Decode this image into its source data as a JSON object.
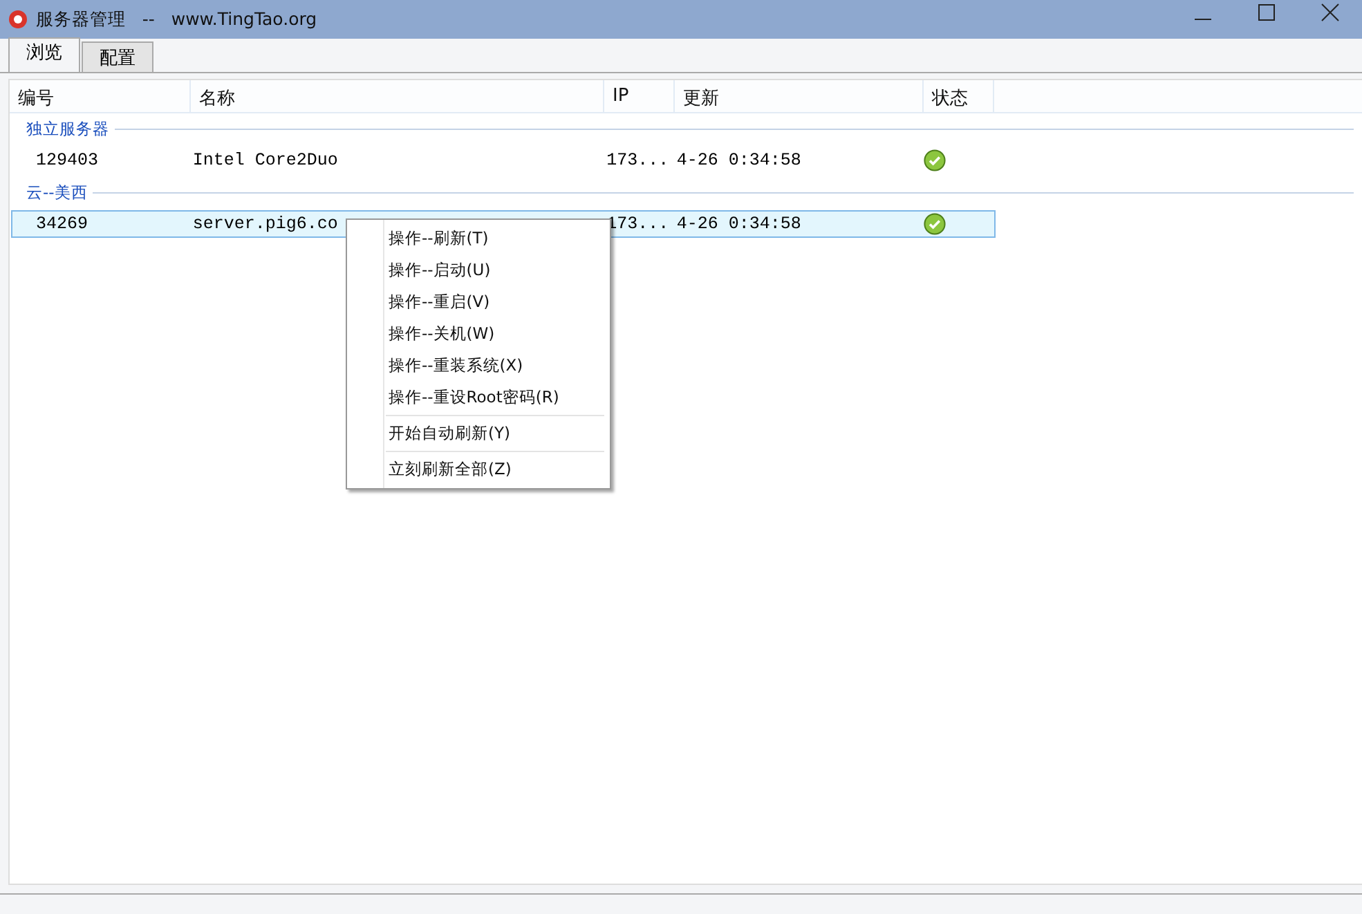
{
  "window": {
    "title": "服务器管理   --   www.TingTao.org"
  },
  "tabs": [
    {
      "label": "浏览",
      "selected": true
    },
    {
      "label": "配置",
      "selected": false
    }
  ],
  "table": {
    "columns": [
      "编号",
      "名称",
      "IP",
      "更新",
      "状态"
    ],
    "groups": [
      {
        "label": "独立服务器",
        "rows": [
          {
            "id": "129403",
            "name": "Intel Core2Duo",
            "ip": "173...",
            "updated": "4-26 0:34:58",
            "healthy": true,
            "selected": false
          }
        ]
      },
      {
        "label": "云--美西",
        "rows": [
          {
            "id": "34269",
            "name": "server.pig6.co",
            "ip": "173...",
            "updated": "4-26 0:34:58",
            "healthy": true,
            "selected": true
          }
        ]
      }
    ]
  },
  "context_menu": {
    "groups": [
      [
        "操作--刷新(T)",
        "操作--启动(U)",
        "操作--重启(V)",
        "操作--关机(W)",
        "操作--重装系统(X)",
        "操作--重设Root密码(R)"
      ],
      [
        "开始自动刷新(Y)"
      ],
      [
        "立刻刷新全部(Z)"
      ]
    ]
  }
}
